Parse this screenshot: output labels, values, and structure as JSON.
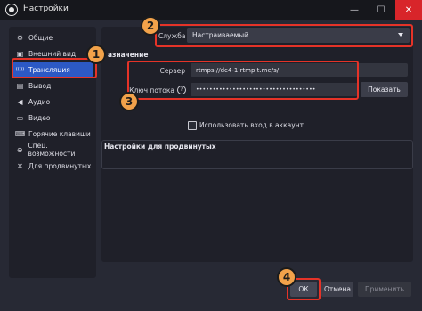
{
  "window": {
    "title": "Настройки",
    "minimize": "—",
    "maximize": "☐",
    "close": "✕"
  },
  "sidebar": {
    "items": [
      {
        "label": "Общие",
        "icon": "gear-icon",
        "glyph": "⚙"
      },
      {
        "label": "Внешний вид",
        "icon": "appearance-icon",
        "glyph": "▣"
      },
      {
        "label": "Трансляция",
        "icon": "broadcast-icon",
        "glyph": "((·))",
        "active": true
      },
      {
        "label": "Вывод",
        "icon": "output-icon",
        "glyph": "▤"
      },
      {
        "label": "Аудио",
        "icon": "audio-icon",
        "glyph": "◀"
      },
      {
        "label": "Видео",
        "icon": "video-icon",
        "glyph": "▭"
      },
      {
        "label": "Горячие клавиши",
        "icon": "keyboard-icon",
        "glyph": "⌨"
      },
      {
        "label": "Спец. возможности",
        "icon": "accessibility-icon",
        "glyph": "⊕"
      },
      {
        "label": "Для продвинутых",
        "icon": "wrench-icon",
        "glyph": "✕"
      }
    ]
  },
  "stream": {
    "service_label": "Служба",
    "service_value": "Настраиваемый...",
    "destination_partial": "азначение",
    "server_label": "Сервер",
    "server_value": "rtmps://dc4-1.rtmp.t.me/s/",
    "key_label": "Ключ потока",
    "help_glyph": "?",
    "key_value": "••••••••••••••••••••••••••••••••••••",
    "show_button": "Показать",
    "use_account_label": "Использовать вход в аккаунт",
    "advanced_title": "Настройки для продвинутых"
  },
  "footer": {
    "ok": "ОК",
    "cancel": "Отмена",
    "apply": "Применить"
  },
  "callouts": [
    "1",
    "2",
    "3",
    "4"
  ],
  "colors": {
    "accent": "#2c59c5",
    "highlight": "#e53328",
    "callout": "#f2a24a",
    "close": "#d8252a"
  }
}
